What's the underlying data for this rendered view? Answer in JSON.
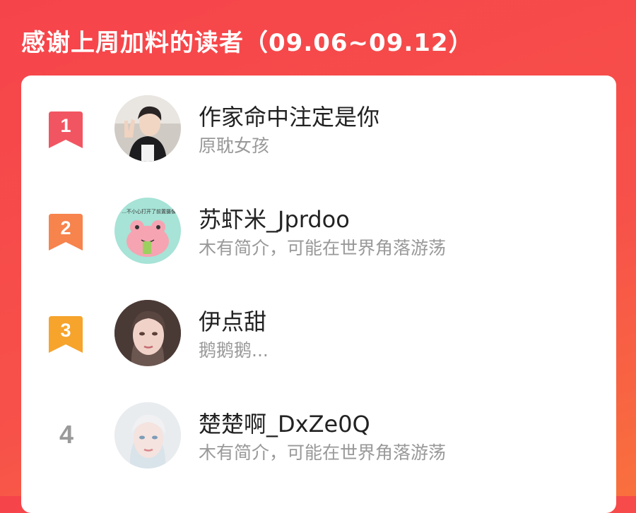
{
  "header": {
    "title": "感谢上周加料的读者（09.06~09.12）"
  },
  "readers": [
    {
      "rank": "1",
      "name": "作家命中注定是你",
      "bio": "原耽女孩",
      "badge_color": "#f25562",
      "avatar": "boy-peace-sign"
    },
    {
      "rank": "2",
      "name": "苏虾米_Jprdoo",
      "bio": "木有简介，可能在世界角落游荡",
      "badge_color": "#f7834d",
      "avatar": "pink-frog-cartoon"
    },
    {
      "rank": "3",
      "name": "伊点甜",
      "bio": "鹅鹅鹅...",
      "badge_color": "#f6a42c",
      "avatar": "girl-portrait"
    },
    {
      "rank": "4",
      "name": "楚楚啊_DxZe0Q",
      "bio": "木有简介，可能在世界角落游荡",
      "avatar": "girl-portrait-pale"
    }
  ],
  "avatar_text": "…不小心打开了前置摄像头"
}
